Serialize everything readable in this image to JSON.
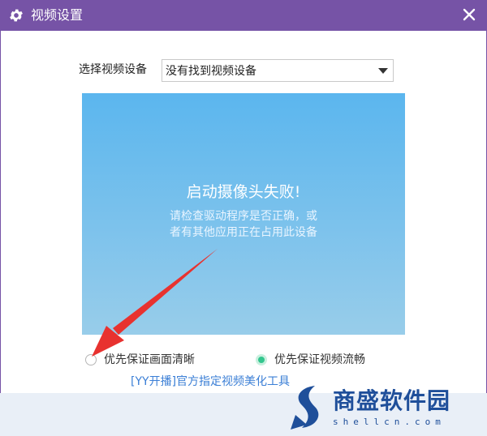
{
  "window": {
    "title": "视频设置",
    "title_icon": "gear-icon",
    "close_icon": "close-icon",
    "accent_color": "#7653a6"
  },
  "device": {
    "label": "选择视频设备",
    "selected": "没有找到视频设备"
  },
  "preview": {
    "message": "启动摄像头失败!",
    "hint_line1": "请检查驱动程序是否正确，或",
    "hint_line2": "者有其他应用正在占用此设备",
    "background_color": "#6fbdee"
  },
  "options": {
    "clarity_label": "优先保证画面清晰",
    "clarity_selected": false,
    "fluency_label": "优先保证视频流畅",
    "fluency_selected": true,
    "selected_color": "#33c68e"
  },
  "beauty_link": "[YY开播]官方指定视频美化工具",
  "watermark": {
    "brand": "商盛软件园",
    "url": "shellcn.com"
  },
  "annotation": {
    "arrow_color": "#e8322f"
  }
}
